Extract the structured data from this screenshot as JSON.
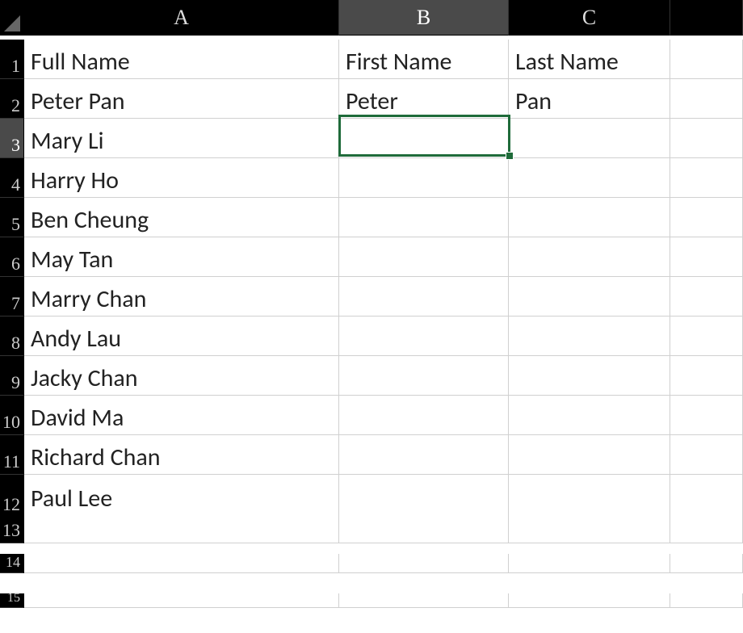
{
  "columns": [
    "A",
    "B",
    "C"
  ],
  "rows": [
    "1",
    "2",
    "3",
    "4",
    "5",
    "6",
    "7",
    "8",
    "9",
    "10",
    "11",
    "12",
    "13",
    "14",
    "15"
  ],
  "selected_column_index": 1,
  "selected_row_index": 2,
  "active_cell": "B3",
  "cells": {
    "A1": "Full Name",
    "B1": "First Name",
    "C1": "Last Name",
    "A2": "Peter Pan",
    "B2": "Peter",
    "C2": "Pan",
    "A3": "Mary Li",
    "A4": "Harry Ho",
    "A5": "Ben Cheung",
    "A6": "May Tan",
    "A7": "Marry Chan",
    "A8": "Andy Lau",
    "A9": "Jacky Chan",
    "A10": "David Ma",
    "A11": "Richard Chan",
    "A12": "Paul Lee"
  }
}
